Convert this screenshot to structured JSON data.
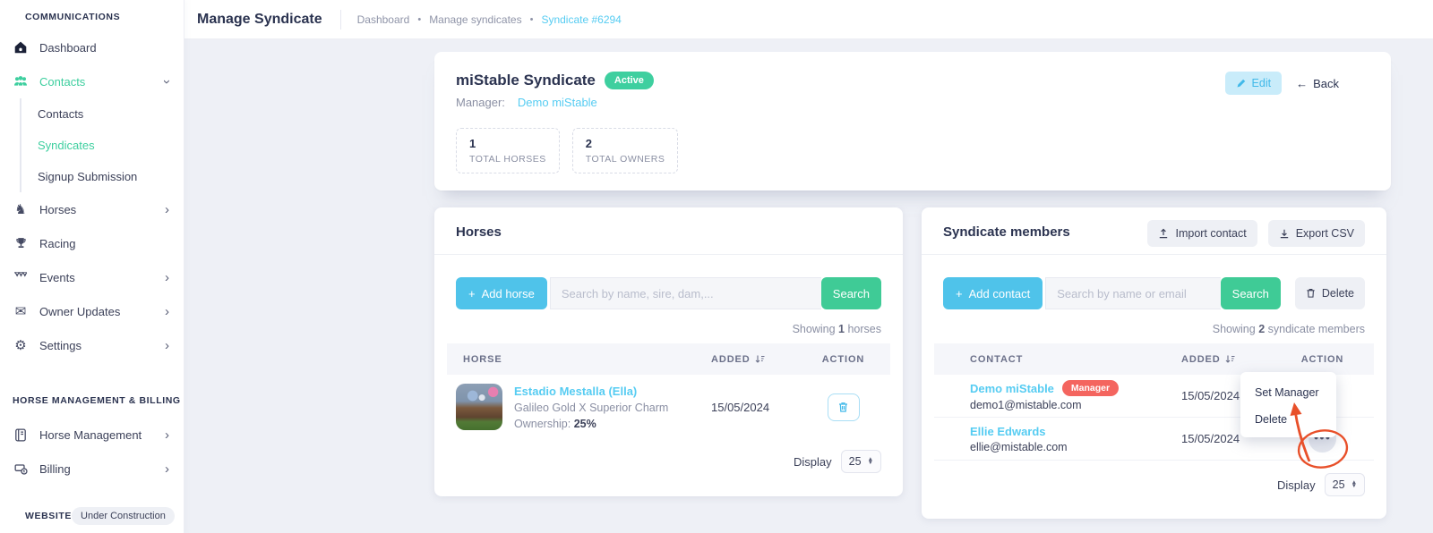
{
  "colors": {
    "accent_teal": "#3ecf9f",
    "sky_blue": "#4fc3ea",
    "green": "#3fcb96",
    "link_blue": "#56ccf2",
    "badge_red": "#f4655f",
    "annotation_red": "#e8502a",
    "dark_navy": "#2b3350"
  },
  "icons": {
    "plus": "+",
    "back_arrow": "←",
    "dots": "●●●",
    "chevron": "›",
    "select_up": "▲",
    "select_down": "▼",
    "knight_horse": "♞",
    "gear": "⚙",
    "envelope": "✉",
    "crumb_sep": "•"
  },
  "sidebar": {
    "label_communications": "COMMUNICATIONS",
    "dashboard": "Dashboard",
    "contacts": "Contacts",
    "sub_contacts": "Contacts",
    "sub_syndicates": "Syndicates",
    "sub_signup": "Signup Submission",
    "horses": "Horses",
    "racing": "Racing",
    "events": "Events",
    "owner_updates": "Owner Updates",
    "settings": "Settings",
    "label_horse_mgmt_billing": "HORSE MANAGEMENT & BILLING",
    "horse_management": "Horse Management",
    "billing": "Billing",
    "label_website": "WEBSITE",
    "under_construction": "Under Construction"
  },
  "header": {
    "title": "Manage Syndicate",
    "crumb1": "Dashboard",
    "crumb2": "Manage syndicates",
    "crumb3": "Syndicate #6294"
  },
  "syndicate_card": {
    "title": "miStable Syndicate",
    "status": "Active",
    "manager_label": "Manager:",
    "manager_name": "Demo miStable",
    "stat1_value": "1",
    "stat1_label": "TOTAL HORSES",
    "stat2_value": "2",
    "stat2_label": "TOTAL OWNERS",
    "edit_label": "Edit",
    "back_label": "Back"
  },
  "horses_panel": {
    "title": "Horses",
    "add_label": "Add horse",
    "search_placeholder": "Search by name, sire, dam,...",
    "search_label": "Search",
    "showing_prefix": "Showing",
    "showing_count": "1",
    "showing_suffix": "horses",
    "col_horse": "HORSE",
    "col_added": "ADDED",
    "col_action": "ACTION",
    "rows": [
      {
        "name": "Estadio Mestalla (Ella)",
        "pedigree": "Galileo Gold X Superior Charm",
        "ownership_label": "Ownership:",
        "ownership": "25%",
        "added": "15/05/2024"
      }
    ],
    "display_label": "Display",
    "page_size": "25"
  },
  "members_panel": {
    "title": "Syndicate members",
    "import_label": "Import contact",
    "export_label": "Export CSV",
    "add_label": "Add contact",
    "search_placeholder": "Search by name or email",
    "search_label": "Search",
    "delete_label": "Delete",
    "showing_prefix": "Showing",
    "showing_count": "2",
    "showing_suffix": "syndicate members",
    "col_contact": "CONTACT",
    "col_added": "ADDED",
    "col_action": "ACTION",
    "rows": [
      {
        "name": "Demo miStable",
        "badge": "Manager",
        "email": "demo1@mistable.com",
        "added": "15/05/2024"
      },
      {
        "name": "Ellie Edwards",
        "email": "ellie@mistable.com",
        "added": "15/05/2024"
      }
    ],
    "menu_item1": "Set Manager",
    "menu_item2": "Delete",
    "display_label": "Display",
    "page_size": "25"
  }
}
